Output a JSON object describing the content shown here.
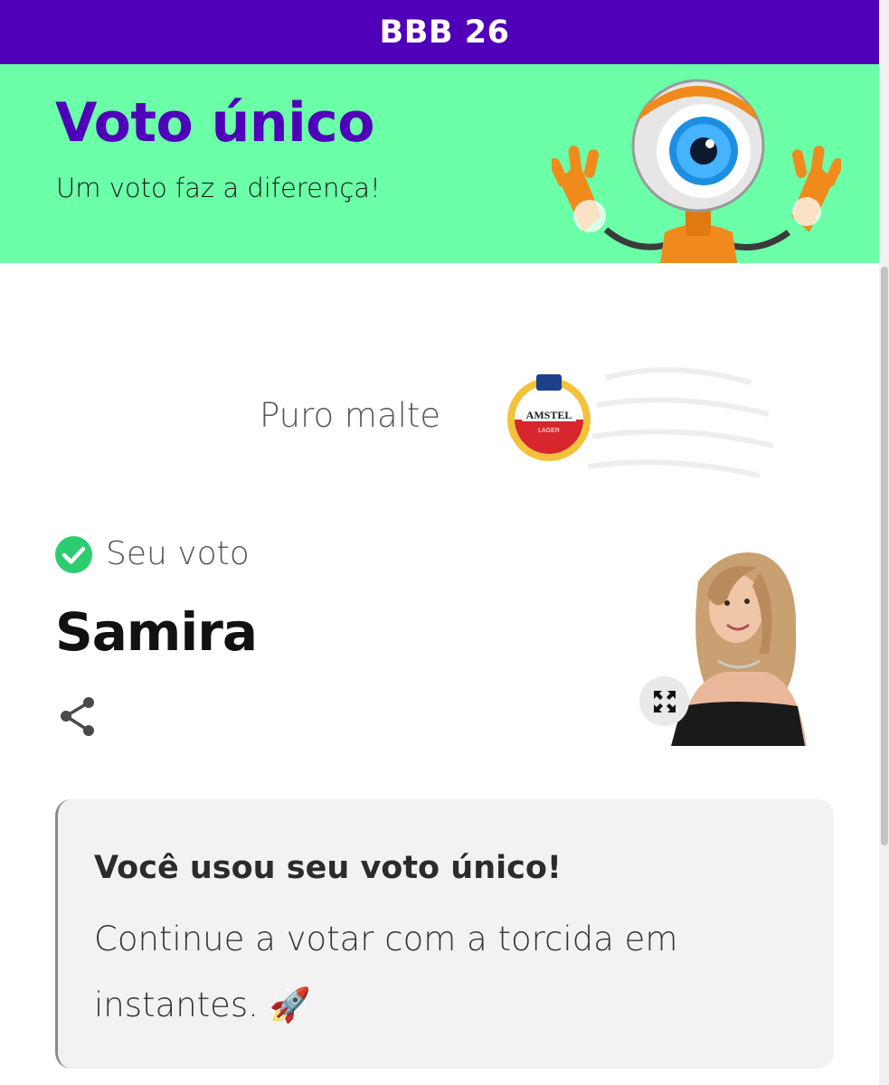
{
  "topbar": {
    "title": "BBB 26"
  },
  "hero": {
    "title": "Voto único",
    "subtitle": "Um voto faz a diferença!",
    "background_color": "#6bffa8",
    "accent_color": "#5000b9",
    "mascot_icon": "big-brother-eye-robot"
  },
  "sponsor": {
    "label": "Puro malte",
    "logo_icon": "amstel-lager-logo",
    "logo_text": "AMSTEL",
    "logo_subtext": "LAGER"
  },
  "vote": {
    "label": "Seu voto",
    "status_icon": "check-circle-icon",
    "status_color": "#2ecc71",
    "candidate": "Samira",
    "share_icon": "share-icon",
    "expand_icon": "expand-icon",
    "photo": "candidate-photo"
  },
  "notice": {
    "title": "Você usou seu voto único!",
    "body": "Continue a votar com a torcida em instantes. 🚀"
  }
}
